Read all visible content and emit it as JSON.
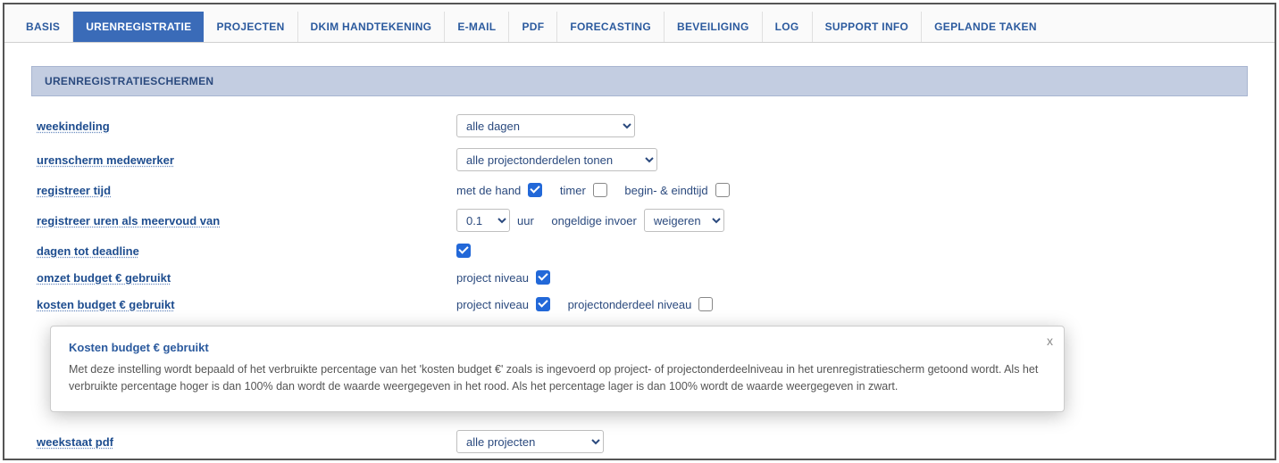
{
  "tabs": [
    {
      "label": "BASIS"
    },
    {
      "label": "URENREGISTRATIE"
    },
    {
      "label": "PROJECTEN"
    },
    {
      "label": "DKIM HANDTEKENING"
    },
    {
      "label": "E-MAIL"
    },
    {
      "label": "PDF"
    },
    {
      "label": "FORECASTING"
    },
    {
      "label": "BEVEILIGING"
    },
    {
      "label": "LOG"
    },
    {
      "label": "SUPPORT INFO"
    },
    {
      "label": "GEPLANDE TAKEN"
    }
  ],
  "section": {
    "title": "URENREGISTRATIESCHERMEN"
  },
  "rows": {
    "weekindeling": {
      "label": "weekindeling",
      "select_value": "alle dagen"
    },
    "urenscherm_medewerker": {
      "label": "urenscherm medewerker",
      "select_value": "alle projectonderdelen tonen"
    },
    "registreer_tijd": {
      "label": "registreer tijd",
      "opt1": "met de hand",
      "opt2": "timer",
      "opt3": "begin- & eindtijd"
    },
    "registreer_uren_meervoud": {
      "label": "registreer uren als meervoud van",
      "value_select": "0.1",
      "unit": "uur",
      "invalid_label": "ongeldige invoer",
      "invalid_select": "weigeren"
    },
    "dagen_tot_deadline": {
      "label": "dagen tot deadline"
    },
    "omzet_budget": {
      "label": "omzet budget € gebruikt",
      "opt1": "project niveau"
    },
    "kosten_budget": {
      "label": "kosten budget € gebruikt",
      "opt1": "project niveau",
      "opt2": "projectonderdeel niveau"
    },
    "weekstaat_pdf": {
      "label": "weekstaat pdf",
      "select_value": "alle projecten"
    }
  },
  "tooltip": {
    "title": "Kosten budget € gebruikt",
    "body": "Met deze instelling wordt bepaald of het verbruikte percentage van het 'kosten budget €' zoals is ingevoerd op project- of projectonderdeelniveau in het urenregistratiescherm getoond wordt. Als het verbruikte percentage hoger is dan 100% dan wordt de waarde weergegeven in het rood. Als het percentage lager is dan 100% wordt de waarde weergegeven in zwart.",
    "close": "x"
  }
}
